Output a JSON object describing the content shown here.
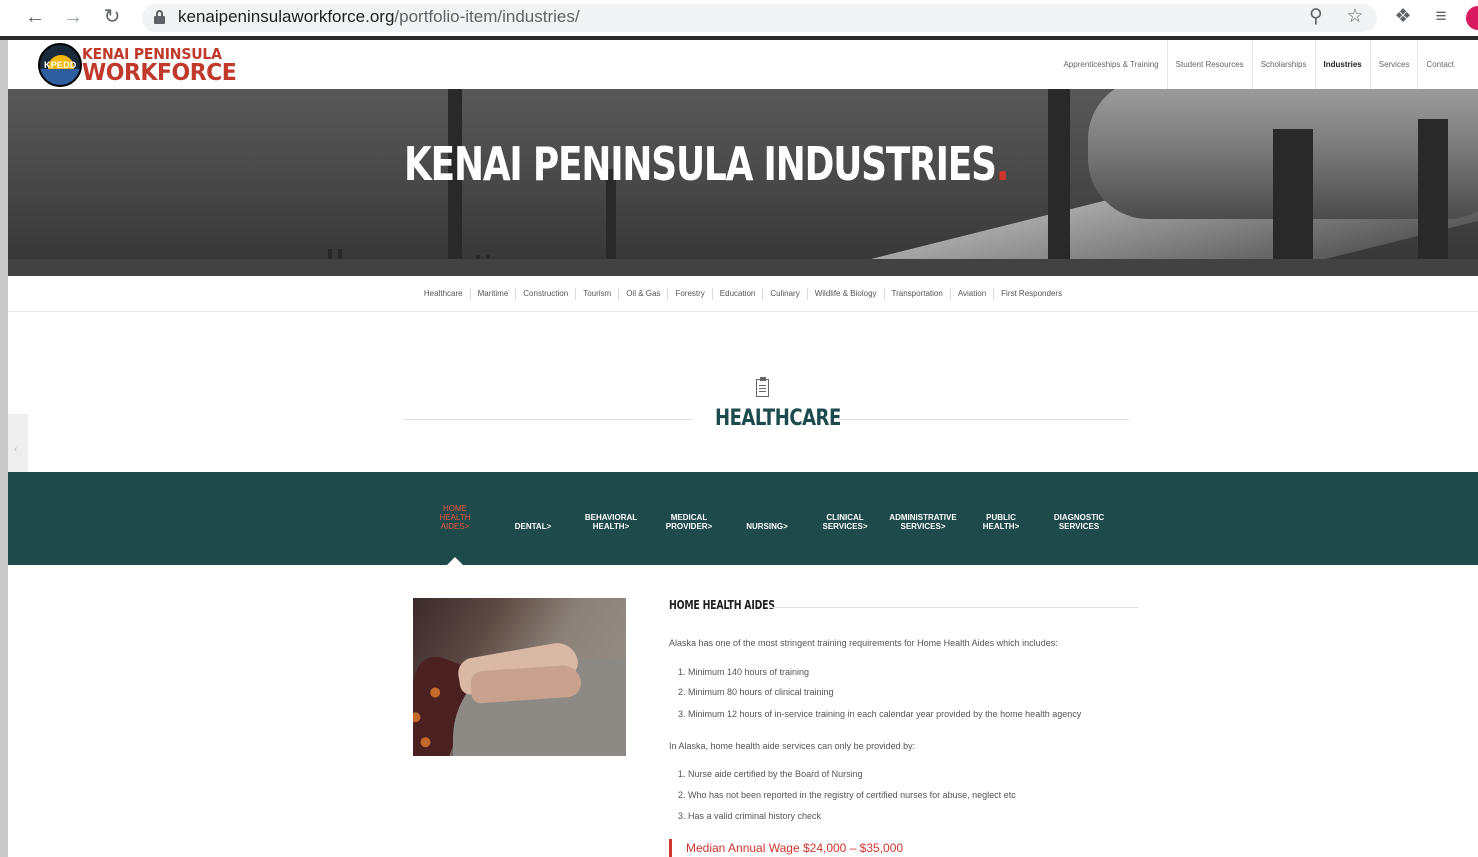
{
  "browser": {
    "url_domain": "kenaipeninsulaworkforce.org",
    "url_path": "/portfolio-item/industries/",
    "back_icon": "arrow-left",
    "forward_icon": "arrow-right",
    "reload_icon": "reload",
    "zoom_icon": "magnifier",
    "bookmark_icon": "star",
    "extensions_icon": "puzzle",
    "media_icon": "playlist"
  },
  "site": {
    "logo_badge_text": "KPEDD",
    "logo_line1": "KENAI PENINSULA",
    "logo_line2": "WORKFORCE",
    "nav": [
      {
        "label": "Apprenticeships & Training",
        "active": false
      },
      {
        "label": "Student Resources",
        "active": false
      },
      {
        "label": "Scholarships",
        "active": false
      },
      {
        "label": "Industries",
        "active": true
      },
      {
        "label": "Services",
        "active": false
      },
      {
        "label": "Contact",
        "active": false
      }
    ]
  },
  "hero": {
    "title": "KENAI PENINSULA INDUSTRIES",
    "title_dot": "."
  },
  "industries_nav": [
    "Healthcare",
    "Maritime",
    "Construction",
    "Tourism",
    "Oil & Gas",
    "Forestry",
    "Education",
    "Culinary",
    "Wildlife & Biology",
    "Transportation",
    "Aviation",
    "First Responders"
  ],
  "section": {
    "icon": "document-icon",
    "title": "HEALTHCARE",
    "side_tab_glyph": "‹"
  },
  "tabs": [
    {
      "label_lines": [
        "HOME",
        "HEALTH",
        "AIDES>"
      ],
      "active": true
    },
    {
      "label_lines": [
        "DENTAL>"
      ],
      "active": false
    },
    {
      "label_lines": [
        "BEHAVIORAL",
        "HEALTH>"
      ],
      "active": false
    },
    {
      "label_lines": [
        "MEDICAL",
        "PROVIDER>"
      ],
      "active": false
    },
    {
      "label_lines": [
        "NURSING>"
      ],
      "active": false
    },
    {
      "label_lines": [
        "CLINICAL",
        "SERVICES>"
      ],
      "active": false
    },
    {
      "label_lines": [
        "ADMINISTRATIVE",
        "SERVICES>"
      ],
      "active": false
    },
    {
      "label_lines": [
        "PUBLIC",
        "HEALTH>"
      ],
      "active": false
    },
    {
      "label_lines": [
        "DIAGNOSTIC",
        "SERVICES"
      ],
      "active": false
    }
  ],
  "content": {
    "heading": "HOME HEALTH AIDES",
    "intro": "Alaska has one of the most stringent training requirements for Home Health Aides which includes:",
    "requirements": [
      "1. Minimum 140 hours of training",
      "2. Minimum 80 hours of clinical training",
      "3. Minimum 12 hours of in-service training in each calendar year provided by the home health agency"
    ],
    "providers_intro": "In Alaska, home health aide services can only be provided by:",
    "providers": [
      "1. Nurse aide certified by the Board of Nursing",
      "2. Who has not been reported in the registry of certified nurses for abuse, neglect etc",
      "3. Has a valid criminal history check"
    ],
    "wage": "Median Annual Wage $24,000 – $35,000"
  },
  "colors": {
    "brand_red": "#c0392b",
    "accent_red": "#d0342c",
    "teal": "#1f4a4b",
    "heading_teal": "#1d4b4d"
  }
}
